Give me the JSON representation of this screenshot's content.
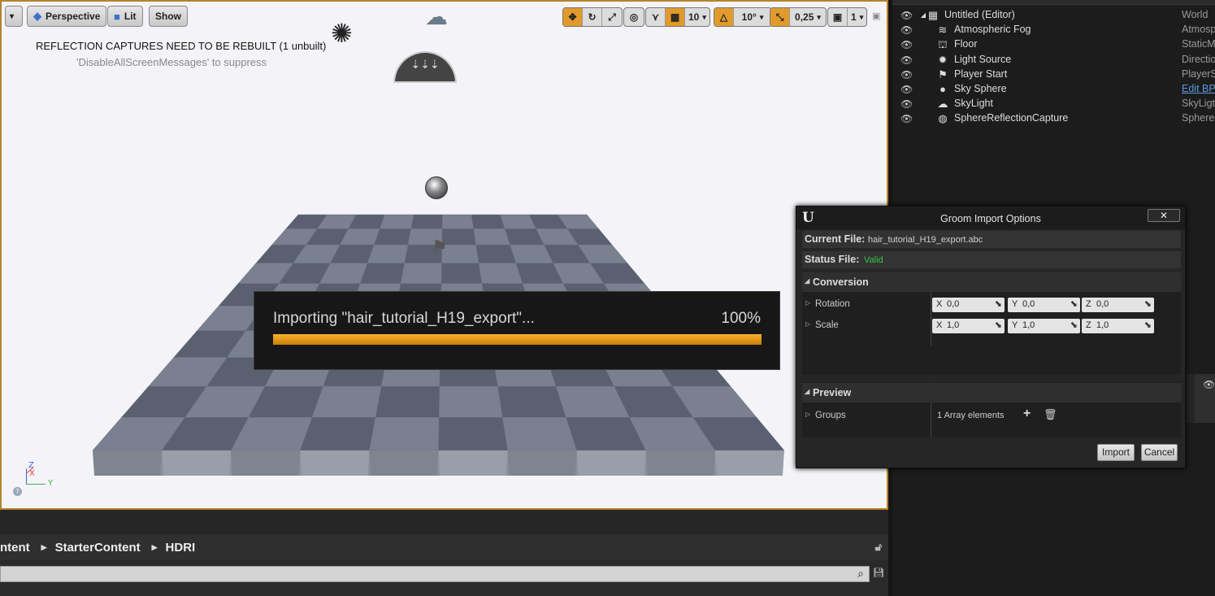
{
  "viewport": {
    "menu_arrow": "▾",
    "perspective_label": "Perspective",
    "lit_label": "Lit",
    "show_label": "Show",
    "message_line1": "REFLECTION CAPTURES NEED TO BE REBUILT (1 unbuilt)",
    "message_line2": "'DisableAllScreenMessages' to suppress",
    "toolbar": {
      "grid_snap_value": "10",
      "rotation_snap_value": "10°",
      "scale_snap_value": "0,25",
      "camera_speed_value": "1"
    },
    "axis_labels": {
      "x": "X",
      "y": "Y",
      "z": "Z"
    },
    "accent_color": "#e19a2c",
    "border_color": "#b5822a"
  },
  "import_progress": {
    "label": "Importing \"hair_tutorial_H19_export\"...",
    "percent_text": "100%",
    "fraction": 1.0
  },
  "content_browser": {
    "breadcrumbs": [
      "ntent",
      "StarterContent",
      "HDRI"
    ],
    "search_placeholder": ""
  },
  "outliner": {
    "rows": [
      {
        "name": "Untitled (Editor)",
        "type": "World",
        "icon": "world-icon",
        "glyph": "▦",
        "indent": 0,
        "expand": "◢"
      },
      {
        "name": "Atmospheric Fog",
        "type": "Atmosp",
        "icon": "fog-icon",
        "glyph": "≋",
        "indent": 1
      },
      {
        "name": "Floor",
        "type": "StaticM",
        "icon": "static-mesh-icon",
        "glyph": "⛫",
        "indent": 1
      },
      {
        "name": "Light Source",
        "type": "Directio",
        "icon": "directional-light-icon",
        "glyph": "✹",
        "indent": 1
      },
      {
        "name": "Player Start",
        "type": "PlayerS",
        "icon": "player-start-icon",
        "glyph": "⚑",
        "indent": 1
      },
      {
        "name": "Sky Sphere",
        "type": "Edit BP",
        "type_is_link": true,
        "icon": "sky-sphere-icon",
        "glyph": "●",
        "indent": 1
      },
      {
        "name": "SkyLight",
        "type": "SkyLigt",
        "icon": "skylight-icon",
        "glyph": "☁",
        "indent": 1
      },
      {
        "name": "SphereReflectionCapture",
        "type": "SphereF",
        "icon": "reflection-capture-icon",
        "glyph": "◍",
        "indent": 1
      }
    ]
  },
  "groom_dialog": {
    "logo": "U",
    "title": "Groom Import Options",
    "close_label": "✕",
    "current_file_label": "Current File:",
    "current_file_value": "hair_tutorial_H19_export.abc",
    "status_file_label": "Status File:",
    "status_file_value": "Valid",
    "conversion_label": "Conversion",
    "rotation_label": "Rotation",
    "rotation": {
      "x": "0,0",
      "y": "0,0",
      "z": "0,0"
    },
    "scale_label": "Scale",
    "scale": {
      "x": "1,0",
      "y": "1,0",
      "z": "1,0"
    },
    "preview_label": "Preview",
    "groups_label": "Groups",
    "groups_value": "1 Array elements",
    "import_label": "Import",
    "cancel_label": "Cancel",
    "status_color": "#38c24a"
  }
}
